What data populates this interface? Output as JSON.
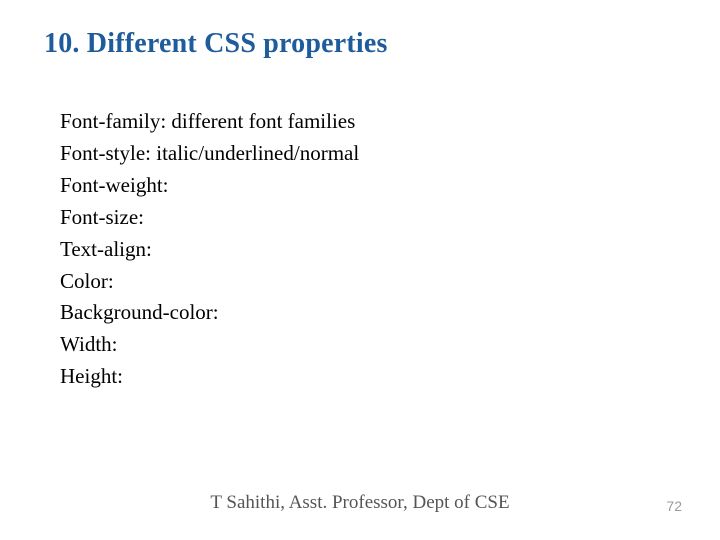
{
  "title": "10. Different CSS properties",
  "lines": [
    "Font-family: different font families",
    "Font-style: italic/underlined/normal",
    "Font-weight:",
    "Font-size:",
    "Text-align:",
    "Color:",
    "Background-color:",
    "Width:",
    "Height:"
  ],
  "footer": "T Sahithi, Asst. Professor, Dept of CSE",
  "page_number": "72"
}
